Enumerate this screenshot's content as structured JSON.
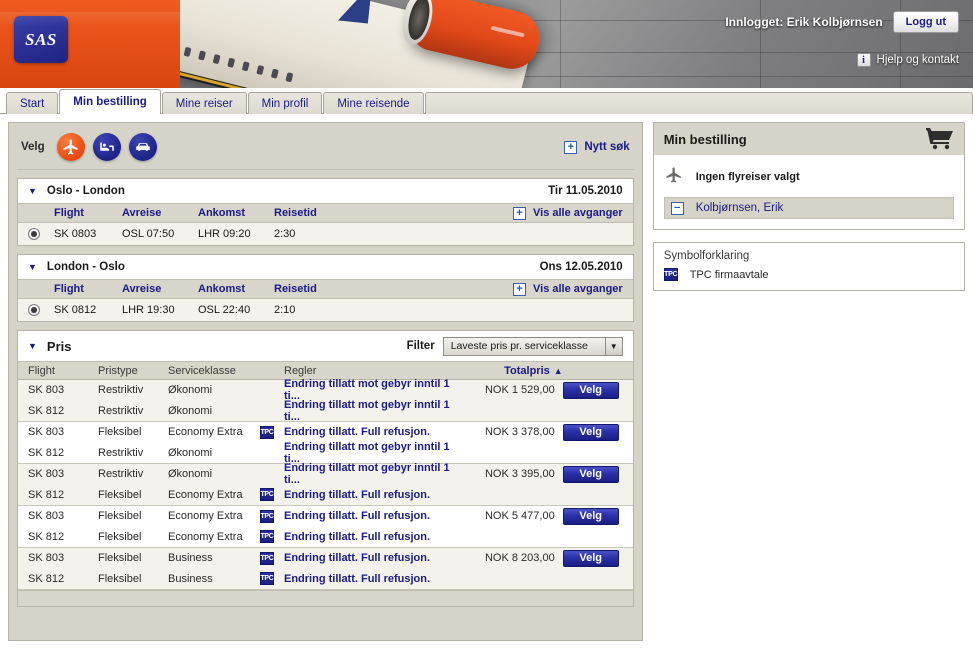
{
  "header": {
    "logo_text": "SAS",
    "logged_in_label": "Innlogget: Erik Kolbjørnsen",
    "logout_label": "Logg ut",
    "help_icon_glyph": "i",
    "help_label": "Hjelp og kontakt",
    "brand_orange": "#e8511a",
    "brand_blue": "#1f2480"
  },
  "tabs": [
    {
      "label": "Start",
      "active": false
    },
    {
      "label": "Min bestilling",
      "active": true
    },
    {
      "label": "Mine reiser",
      "active": false
    },
    {
      "label": "Min profil",
      "active": false
    },
    {
      "label": "Mine reisende",
      "active": false
    }
  ],
  "toolbar": {
    "label": "Velg",
    "icons": [
      {
        "name": "plane-icon",
        "active": true
      },
      {
        "name": "hotel-icon",
        "active": false
      },
      {
        "name": "car-icon",
        "active": false
      }
    ],
    "new_search_label": "Nytt søk",
    "plus_glyph": "+"
  },
  "segments": [
    {
      "title": "Oslo - London",
      "date": "Tir 11.05.2010",
      "triangle": "▼",
      "columns": {
        "flight": "Flight",
        "departure": "Avreise",
        "arrival": "Ankomst",
        "duration": "Reisetid",
        "show_all": "Vis alle avganger"
      },
      "rows": [
        {
          "selected": true,
          "flight": "SK 0803",
          "departure": "OSL 07:50",
          "arrival": "LHR 09:20",
          "duration": "2:30"
        }
      ]
    },
    {
      "title": "London - Oslo",
      "date": "Ons 12.05.2010",
      "triangle": "▼",
      "columns": {
        "flight": "Flight",
        "departure": "Avreise",
        "arrival": "Ankomst",
        "duration": "Reisetid",
        "show_all": "Vis alle avganger"
      },
      "rows": [
        {
          "selected": true,
          "flight": "SK 0812",
          "departure": "LHR 19:30",
          "arrival": "OSL 22:40",
          "duration": "2:10"
        }
      ]
    }
  ],
  "price": {
    "title": "Pris",
    "triangle": "▼",
    "filter_label": "Filter",
    "filter_value": "Laveste pris pr. serviceklasse",
    "filter_arrow": "▼",
    "columns": {
      "flight": "Flight",
      "pricetype": "Pristype",
      "serviceclass": "Serviceklasse",
      "rules": "Regler",
      "total": "Totalpris",
      "sort_arrow": "▲"
    },
    "select_label": "Velg",
    "tpc_badge": "TPC",
    "groups": [
      {
        "total": "NOK 1 529,00",
        "rows": [
          {
            "flight": "SK 803",
            "pricetype": "Restriktiv",
            "serviceclass": "Økonomi",
            "tpc": false,
            "rules": "Endring tillatt mot gebyr inntil 1 ti..."
          },
          {
            "flight": "SK 812",
            "pricetype": "Restriktiv",
            "serviceclass": "Økonomi",
            "tpc": false,
            "rules": "Endring tillatt mot gebyr inntil 1 ti..."
          }
        ]
      },
      {
        "total": "NOK 3 378,00",
        "rows": [
          {
            "flight": "SK 803",
            "pricetype": "Fleksibel",
            "serviceclass": "Economy Extra",
            "tpc": true,
            "rules": "Endring tillatt. Full refusjon."
          },
          {
            "flight": "SK 812",
            "pricetype": "Restriktiv",
            "serviceclass": "Økonomi",
            "tpc": false,
            "rules": "Endring tillatt mot gebyr inntil 1 ti..."
          }
        ]
      },
      {
        "total": "NOK 3 395,00",
        "rows": [
          {
            "flight": "SK 803",
            "pricetype": "Restriktiv",
            "serviceclass": "Økonomi",
            "tpc": false,
            "rules": "Endring tillatt mot gebyr inntil 1 ti..."
          },
          {
            "flight": "SK 812",
            "pricetype": "Fleksibel",
            "serviceclass": "Economy Extra",
            "tpc": true,
            "rules": "Endring tillatt. Full refusjon."
          }
        ]
      },
      {
        "total": "NOK 5 477,00",
        "rows": [
          {
            "flight": "SK 803",
            "pricetype": "Fleksibel",
            "serviceclass": "Economy Extra",
            "tpc": true,
            "rules": "Endring tillatt. Full refusjon."
          },
          {
            "flight": "SK 812",
            "pricetype": "Fleksibel",
            "serviceclass": "Economy Extra",
            "tpc": true,
            "rules": "Endring tillatt. Full refusjon."
          }
        ]
      },
      {
        "total": "NOK 8 203,00",
        "rows": [
          {
            "flight": "SK 803",
            "pricetype": "Fleksibel",
            "serviceclass": "Business",
            "tpc": true,
            "rules": "Endring tillatt. Full refusjon."
          },
          {
            "flight": "SK 812",
            "pricetype": "Fleksibel",
            "serviceclass": "Business",
            "tpc": true,
            "rules": "Endring tillatt. Full refusjon."
          }
        ]
      }
    ]
  },
  "sidebar": {
    "booking": {
      "title": "Min bestilling",
      "no_flights_label": "Ingen flyreiser valgt",
      "passenger": "Kolbjørnsen, Erik",
      "minus_glyph": "−"
    },
    "legend": {
      "title": "Symbolforklaring",
      "items": [
        {
          "badge": "TPC",
          "label": "TPC firmaavtale"
        }
      ]
    }
  }
}
